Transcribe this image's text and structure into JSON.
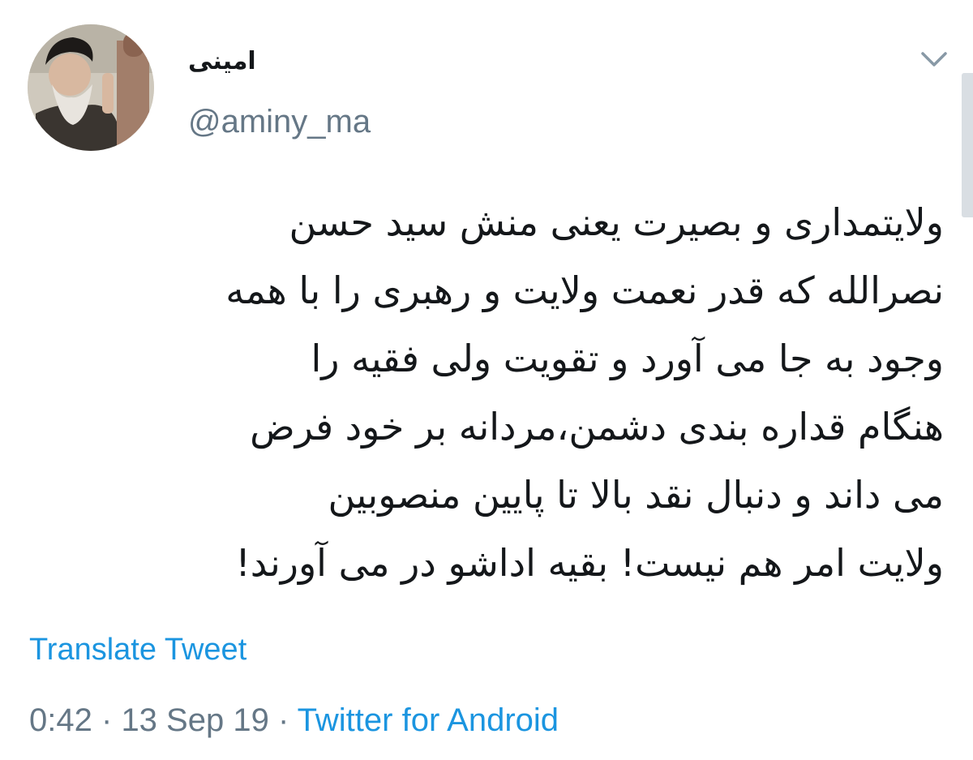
{
  "tweet": {
    "author": {
      "display_name": "امینی",
      "handle": "@aminy_ma"
    },
    "text_lines": [
      "ولایتمداری و بصیرت یعنی منش سید حسن",
      "نصرالله که قدر نعمت ولایت و رهبری را با همه",
      "وجود به جا می آورد و تقویت ولی فقیه را",
      "هنگام قداره بندی دشمن،مردانه بر خود فرض",
      "می داند و دنبال نقد بالا تا پایین منصوبین",
      "ولایت امر هم نیست! بقیه اداشو در می آورند!"
    ],
    "translate_label": "Translate Tweet",
    "time": "0:42",
    "separator": "·",
    "date": "13 Sep 19",
    "source": "Twitter for Android",
    "menu_icon": "chevron-down-icon"
  },
  "colors": {
    "text": "#14171a",
    "secondary": "#657786",
    "link": "#1b95e0"
  }
}
